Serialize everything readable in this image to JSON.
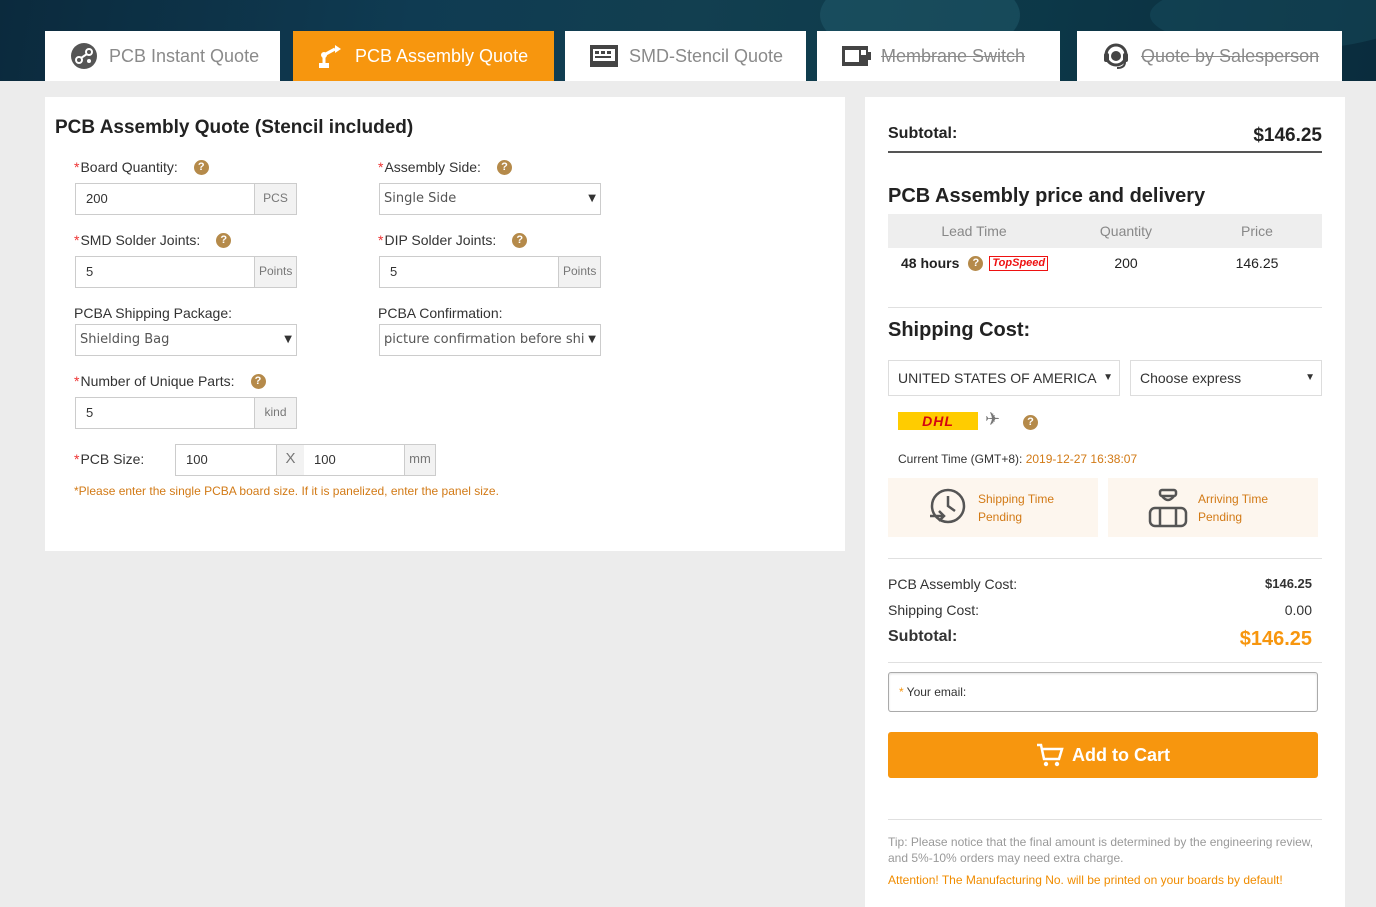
{
  "tabs": [
    {
      "label": "PCB Instant Quote",
      "icon": "pcb-icon"
    },
    {
      "label": "PCB Assembly Quote",
      "icon": "assembly-robot-icon"
    },
    {
      "label": "SMD-Stencil Quote",
      "icon": "stencil-icon"
    },
    {
      "label": "Membrane Switch",
      "icon": "membrane-icon"
    },
    {
      "label": "Quote by Salesperson",
      "icon": "headset-icon"
    }
  ],
  "form": {
    "title": "PCB Assembly Quote (Stencil included)",
    "board_quantity": {
      "label": "Board Quantity:",
      "value": "200",
      "unit": "PCS"
    },
    "assembly_side": {
      "label": "Assembly Side:",
      "value": "Single Side"
    },
    "smd_joints": {
      "label": "SMD Solder Joints:",
      "value": "5",
      "unit": "Points"
    },
    "dip_joints": {
      "label": "DIP Solder Joints:",
      "value": "5",
      "unit": "Points"
    },
    "shipping_package": {
      "label": "PCBA Shipping Package:",
      "value": "Shielding Bag"
    },
    "confirmation": {
      "label": "PCBA Confirmation:",
      "value": "picture confirmation before shi"
    },
    "unique_parts": {
      "label": "Number of Unique Parts:",
      "value": "5",
      "unit": "kind"
    },
    "pcb_size": {
      "label": "PCB Size:",
      "width": "100",
      "x": "X",
      "height": "100",
      "unit": "mm"
    },
    "size_note": "*Please enter the single PCBA board size. If it is panelized, enter the panel size."
  },
  "summary": {
    "subtotal_label": "Subtotal:",
    "subtotal_value": "$146.25",
    "price_title": "PCB Assembly price and delivery",
    "table_headers": [
      "Lead Time",
      "Quantity",
      "Price"
    ],
    "lead_time": "48 hours",
    "topspeed": "TopSpeed",
    "quantity": "200",
    "price": "146.25",
    "shipping_title": "Shipping Cost:",
    "country": "UNITED STATES OF AMERICA",
    "express": "Choose express",
    "carrier": "DHL",
    "current_time_label": "Current Time (GMT+8):",
    "current_time_value": "2019-12-27 16:38:07",
    "shipping_time_label": "Shipping Time",
    "shipping_time_value": "Pending",
    "arriving_time_label": "Arriving Time",
    "arriving_time_value": "Pending",
    "assembly_cost_label": "PCB Assembly Cost:",
    "assembly_cost_value": "$146.25",
    "shipping_cost_label": "Shipping Cost:",
    "shipping_cost_value": "0.00",
    "total_label": "Subtotal:",
    "total_value": "$146.25",
    "email_label": "Your email:",
    "email_star": "*",
    "add_to_cart": "Add to Cart",
    "tip": "Tip: Please notice that the final amount is determined by the engineering review, and 5%-10% orders may need extra charge.",
    "attention": "Attention! The Manufacturing No. will be printed on your boards by default!"
  },
  "colors": {
    "accent": "#f7960e",
    "note": "#d27a16",
    "help": "#b58a4a",
    "required": "#e33333"
  }
}
